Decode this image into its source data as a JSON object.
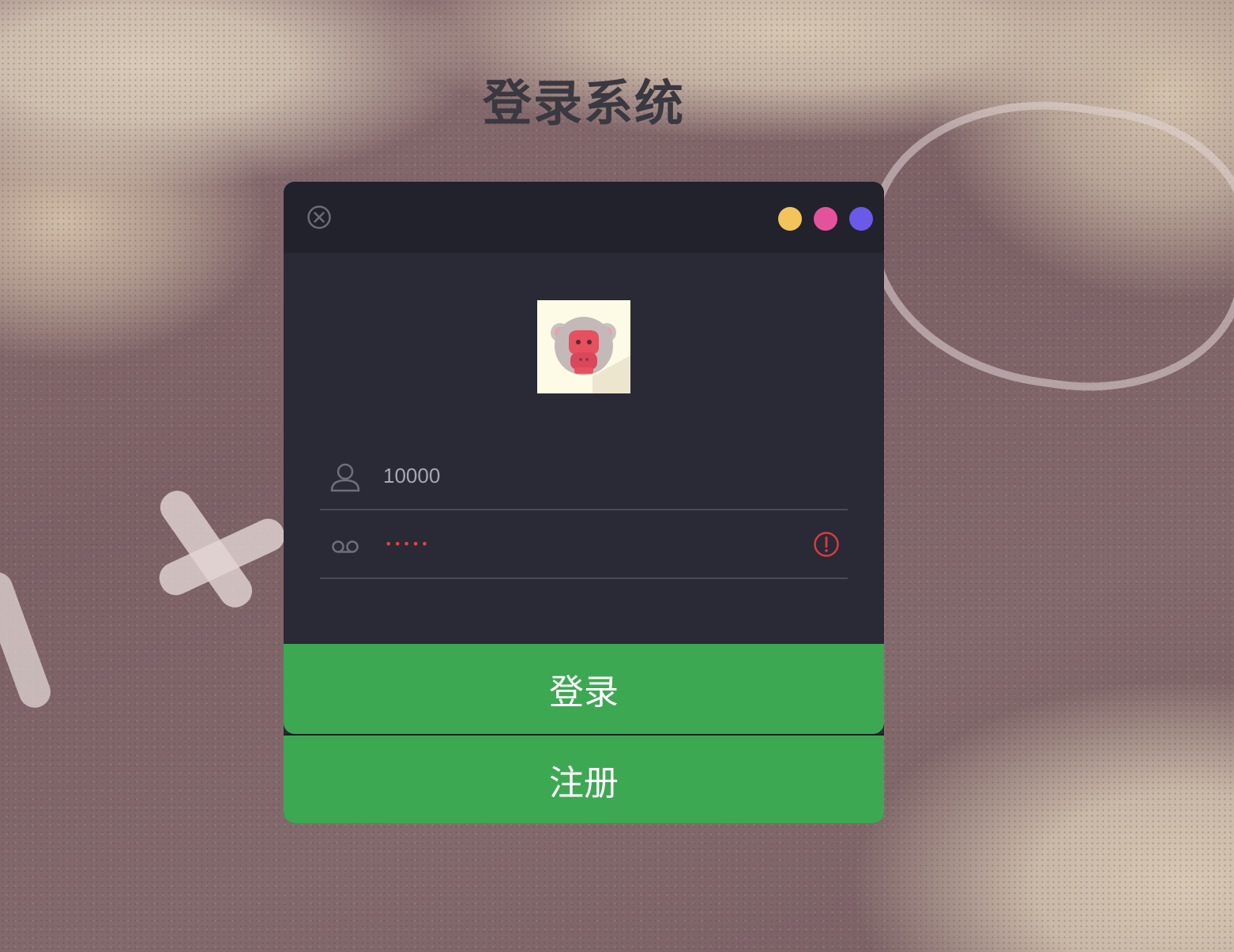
{
  "page": {
    "title": "登录系统"
  },
  "window": {
    "close_icon": "close-circle-icon",
    "dots": [
      {
        "name": "yellow-dot",
        "color": "#f2c45b"
      },
      {
        "name": "pink-dot",
        "color": "#e5529c"
      },
      {
        "name": "purple-dot",
        "color": "#6a5ae9"
      }
    ]
  },
  "avatar": {
    "icon": "monkey-face-icon"
  },
  "form": {
    "username": {
      "value": "10000",
      "icon": "user-icon"
    },
    "password": {
      "masked_value": "•••••",
      "icon": "voicemail-key-icon",
      "status_icon": "warning-icon",
      "status_color": "#d93a40"
    }
  },
  "buttons": {
    "login_label": "登录",
    "register_label": "注册"
  },
  "colors": {
    "panel": "#292a35",
    "titlebar": "#21222c",
    "accent": "#3da852"
  }
}
